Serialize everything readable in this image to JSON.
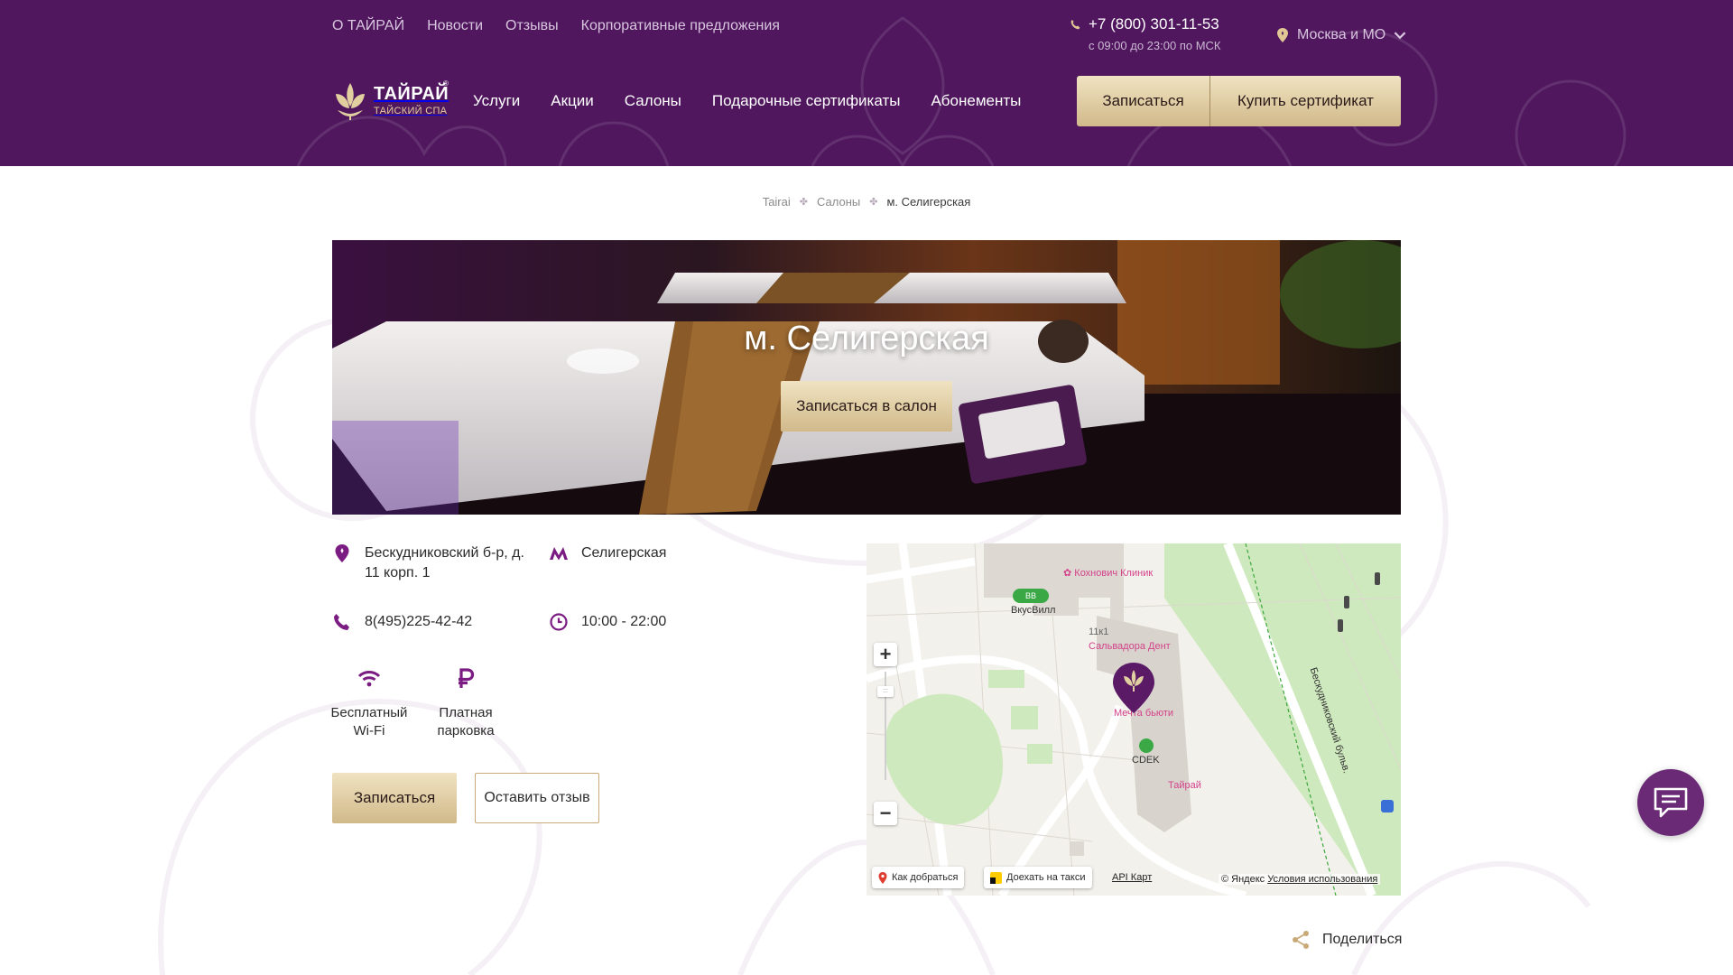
{
  "header": {
    "top_nav": [
      "О ТАЙРАЙ",
      "Новости",
      "Отзывы",
      "Корпоративные предложения"
    ],
    "phone": "+7 (800) 301-11-53",
    "hours": "с 09:00 до 23:00 по МСК",
    "city": "Москва и МО",
    "logo_main": "ТАЙРАЙ",
    "logo_sub": "ТАЙСКИЙ СПА",
    "main_nav": [
      "Услуги",
      "Акции",
      "Салоны",
      "Подарочные сертификаты",
      "Абонементы"
    ],
    "book_label": "Записаться",
    "cert_label": "Купить сертификат",
    "brand_color": "#50175f",
    "gold_color": "#dcc596"
  },
  "breadcrumb": [
    "Tairai",
    "Салоны",
    "м. Селигерская"
  ],
  "hero": {
    "title": "м. Селигерская",
    "button": "Записаться в салон"
  },
  "info": {
    "address": "Бескудниковский б-р, д. 11 корп. 1",
    "metro": "Селигерская",
    "phone": "8(495)225-42-42",
    "hours": "10:00 - 22:00",
    "amenities": [
      "Бесплатный Wi-Fi",
      "Платная парковка"
    ],
    "signup_label": "Записаться",
    "review_label": "Оставить отзыв"
  },
  "map": {
    "labels": {
      "clinic": "Кохнович Клиник",
      "vkusvill": "ВкусВилл",
      "building": "11к1",
      "dent": "Сальвадора Дент",
      "beauty": "Мечта бьюти",
      "cdek": "CDEK",
      "tairai": "Тайрай",
      "street": "Бескудниковский бульв."
    },
    "route_label": "Как добраться",
    "taxi_label": "Доехать на такси",
    "api_label": "API Карт",
    "copyright": "© Яндекс",
    "terms": "Условия использования"
  },
  "share_label": "Поделиться"
}
